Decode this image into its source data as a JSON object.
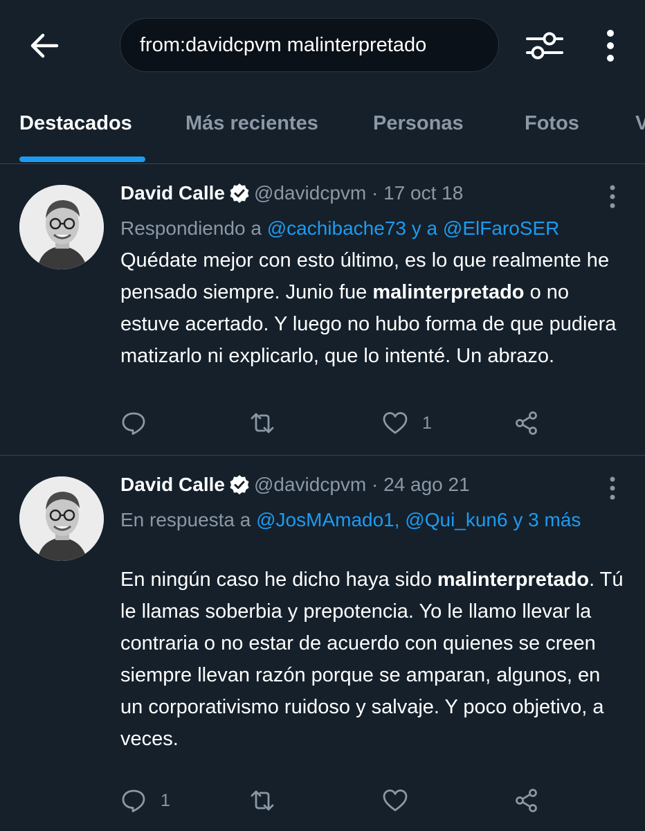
{
  "search": {
    "query": "from:davidcpvm malinterpretado"
  },
  "tabs": [
    {
      "label": "Destacados"
    },
    {
      "label": "Más recientes"
    },
    {
      "label": "Personas"
    },
    {
      "label": "Fotos"
    },
    {
      "label": "V"
    }
  ],
  "tweets": [
    {
      "name": "David Calle",
      "handle": "@davidcpvm",
      "date": "· 17 oct 18",
      "reply_prefix": "Respondiendo a ",
      "mention_1": "@cachibache73",
      "reply_joiner": " y a ",
      "mention_2": "@ElFaroSER",
      "text_before": "Quédate mejor con esto último, es lo que realmente he pensado siempre. Junio fue ",
      "highlight": "malinterpretado",
      "text_after": " o no estuve acertado. Y luego no hubo forma de que pudiera matizarlo ni explicarlo, que lo intenté. Un abrazo.",
      "reply_count": "",
      "retweet_count": "",
      "like_count": "1"
    },
    {
      "name": "David Calle",
      "handle": "@davidcpvm",
      "date": "· 24 ago 21",
      "reply_prefix": "En respuesta a ",
      "mentions": "@JosMAmado1, @Qui_kun6 y 3 más",
      "text_before": "En ningún caso he dicho haya sido ",
      "highlight": "malinterpretado",
      "text_after": ". Tú le llamas soberbia y prepotencia. Yo le llamo llevar la contraria o no estar de acuerdo con quienes se creen siempre llevan razón porque se amparan, algunos, en un corporativismo ruidoso y salvaje. Y poco objetivo, a veces.",
      "reply_count": "1",
      "retweet_count": "",
      "like_count": ""
    }
  ],
  "colors": {
    "background": "#15202b",
    "accent": "#1d9bf0",
    "secondary_text": "#8b98a5",
    "divider": "#38444d"
  },
  "icons": {
    "back": "arrow-left-icon",
    "filter": "sliders-icon",
    "more": "vertical-dots-icon",
    "verified": "verified-badge-icon",
    "reply": "speech-bubble-icon",
    "retweet": "retweet-icon",
    "like": "heart-icon",
    "share": "share-icon"
  }
}
